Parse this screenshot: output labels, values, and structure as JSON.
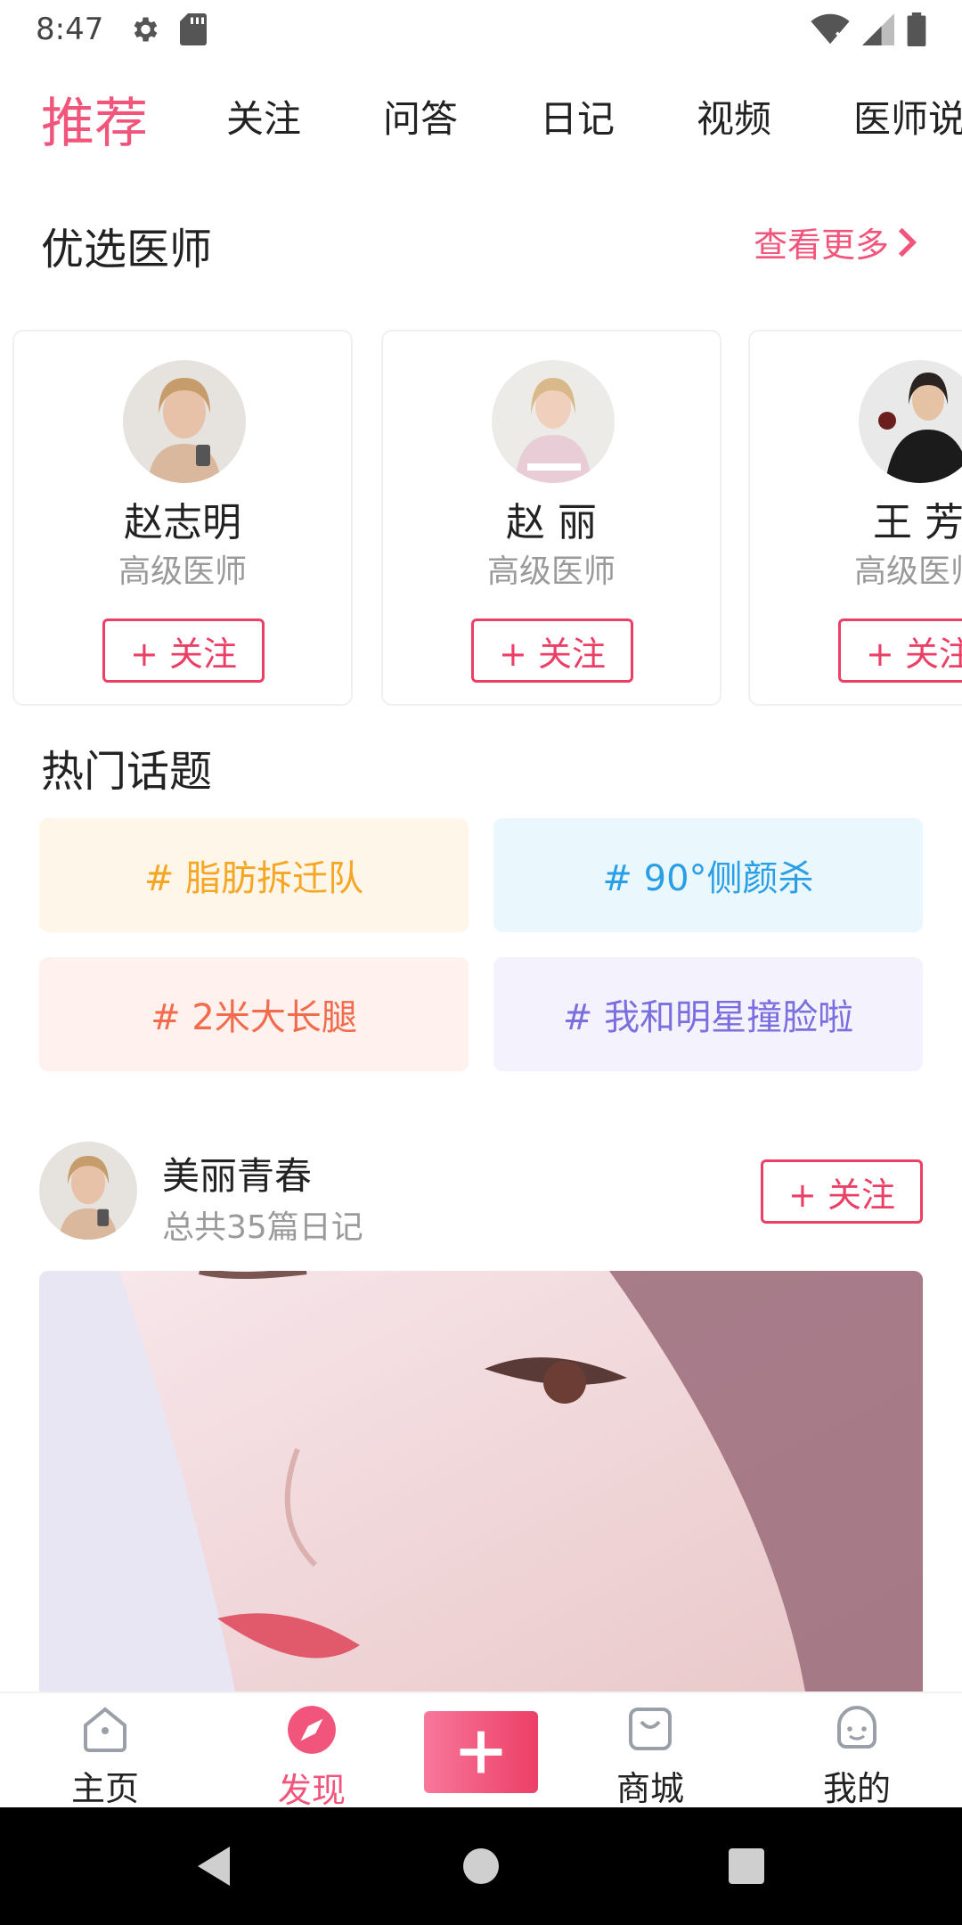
{
  "status_bar": {
    "time": "8:47"
  },
  "top_tabs": [
    {
      "label": "推荐",
      "active": true
    },
    {
      "label": "关注"
    },
    {
      "label": "问答"
    },
    {
      "label": "日记"
    },
    {
      "label": "视频"
    },
    {
      "label": "医师说"
    }
  ],
  "doctors_section": {
    "title": "优选医师",
    "see_more": "查看更多",
    "doctors": [
      {
        "name": "赵志明",
        "title": "高级医师",
        "follow": "+ 关注"
      },
      {
        "name": "赵 丽",
        "title": "高级医师",
        "follow": "+ 关注"
      },
      {
        "name": "王 芳",
        "title": "高级医师",
        "follow": "+ 关注"
      }
    ]
  },
  "topics_section": {
    "title": "热门话题",
    "topics": [
      {
        "label": "# 脂肪拆迁队",
        "color": "#f5a623",
        "bg": "#fff6ea"
      },
      {
        "label": "# 90°侧颜杀",
        "color": "#2a9fe6",
        "bg": "#eaf7fd"
      },
      {
        "label": "# 2米大长腿",
        "color": "#f26b4c",
        "bg": "#fff1ee"
      },
      {
        "label": "# 我和明星撞脸啦",
        "color": "#7b6fe0",
        "bg": "#f4f3fd"
      }
    ]
  },
  "post": {
    "author": "美丽青春",
    "subtitle": "总共35篇日记",
    "follow": "+ 关注"
  },
  "bottom_nav": {
    "items": [
      {
        "label": "主页",
        "icon": "home-icon"
      },
      {
        "label": "发现",
        "icon": "compass-icon",
        "active": true
      },
      {
        "label": "商城",
        "icon": "shopping-bag-icon"
      },
      {
        "label": "我的",
        "icon": "smile-face-icon"
      }
    ],
    "publish_icon": "plus-icon"
  },
  "colors": {
    "accent": "#f1557b",
    "follow_border": "#ec3f66",
    "secondary_text": "#9a9a9a"
  }
}
